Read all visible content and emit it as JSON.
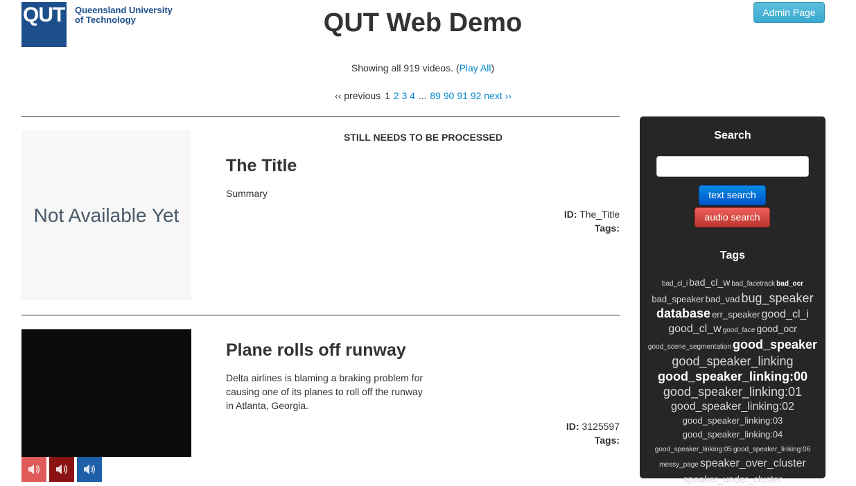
{
  "header": {
    "logo_mark": "QUT",
    "logo_line1": "Queensland University",
    "logo_line2": "of Technology",
    "title": "QUT Web Demo",
    "admin_button": "Admin Page"
  },
  "summary": {
    "prefix": "Showing all 919 videos. (",
    "play_all": "Play All",
    "suffix": ")"
  },
  "pager": {
    "previous": "‹‹ previous",
    "current": "1",
    "pages_a": [
      "2",
      "3",
      "4"
    ],
    "ellipsis": "...",
    "pages_b": [
      "89",
      "90",
      "91",
      "92"
    ],
    "next": "next ››"
  },
  "videos": [
    {
      "status": "STILL NEEDS TO BE PROCESSED",
      "thumbnail_text": "Not Available Yet",
      "title": "The Title",
      "summary": "Summary",
      "id_label": "ID:",
      "id_value": "The_Title",
      "tags_label": "Tags:"
    },
    {
      "title": "Plane rolls off runway",
      "summary": "Delta airlines is blaming a braking problem for causing one of its planes to roll off the runway in Atlanta, Georgia.",
      "id_label": "ID:",
      "id_value": "3125597",
      "tags_label": "Tags:",
      "speaker_colors": [
        "#e05a5a",
        "#8b1212",
        "#1f5fa8"
      ]
    }
  ],
  "sidebar": {
    "search_heading": "Search",
    "search_value": "",
    "text_search": "text search",
    "audio_search": "audio search",
    "tags_heading": "Tags",
    "tags": [
      "bad_cl_i",
      "bad_cl_w",
      "bad_facetrack",
      "bad_ocr",
      "bad_speaker",
      "bad_vad",
      "bug_speaker",
      "database",
      "err_speaker",
      "good_cl_i",
      "good_cl_w",
      "good_face",
      "good_ocr",
      "good_scene_segmentation",
      "good_speaker",
      "good_speaker_linking",
      "good_speaker_linking:00",
      "good_speaker_linking:01",
      "good_speaker_linking:02",
      "good_speaker_linking:03",
      "good_speaker_linking:04",
      "good_speaker_linking:05",
      "good_speaker_linking:06",
      "messy_page",
      "speaker_over_cluster",
      "speaker_under_cluster"
    ]
  }
}
